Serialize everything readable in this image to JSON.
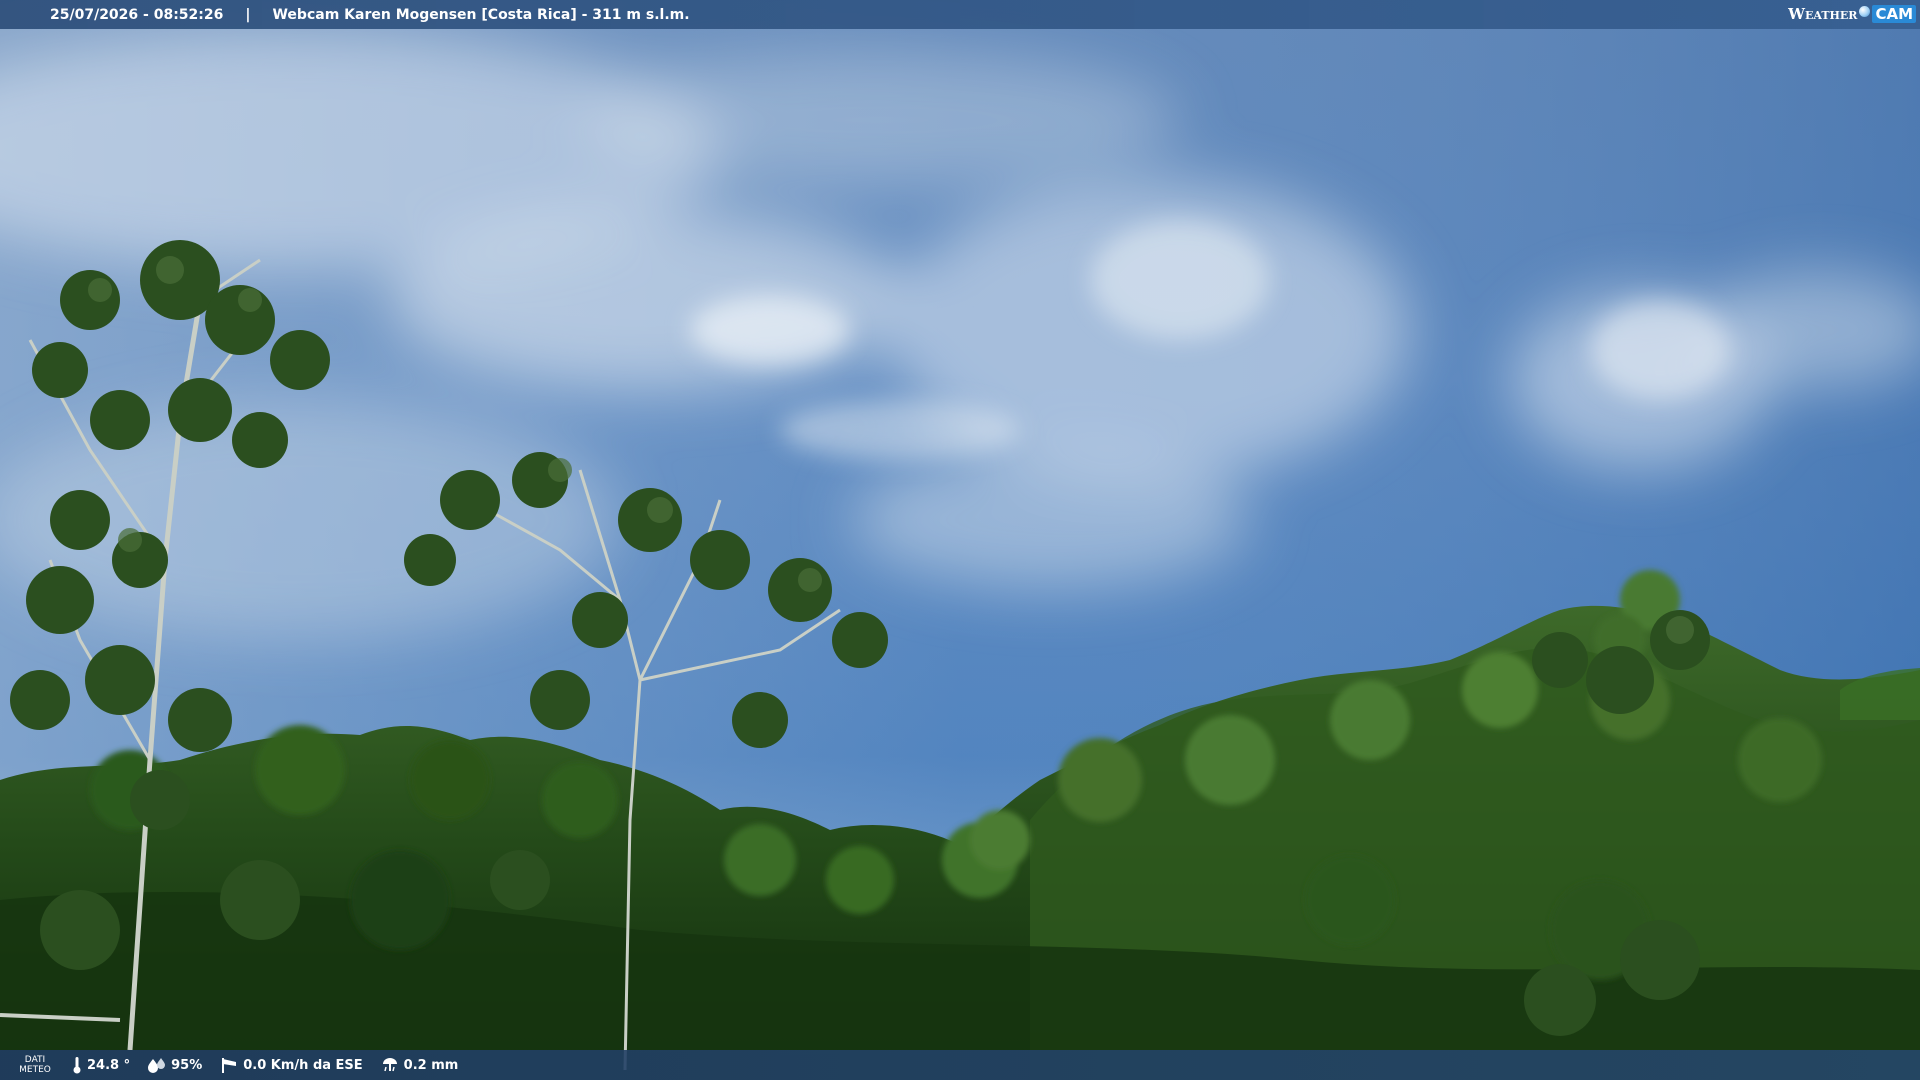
{
  "header": {
    "datetime": "25/07/2026 - 08:52:26",
    "separator": "|",
    "title": "Webcam Karen Mogensen [Costa Rica]  - 311 m s.l.m."
  },
  "logo": {
    "weather": "Weather",
    "cam": "CAM"
  },
  "footer": {
    "dati_line1": "DATI",
    "dati_line2": "METEO",
    "temperature": "24.8 °",
    "humidity": "95%",
    "wind": "0.0 Km/h da ESE",
    "rain": "0.2 mm",
    "icons": [
      "thermometer-icon",
      "humidity-drop-icon",
      "wind-sock-icon",
      "rain-gauge-icon"
    ]
  },
  "colors": {
    "sky_top": "#3f6fa8",
    "sky_horizon": "#7ea4cf",
    "forest": "#1f3d16"
  }
}
